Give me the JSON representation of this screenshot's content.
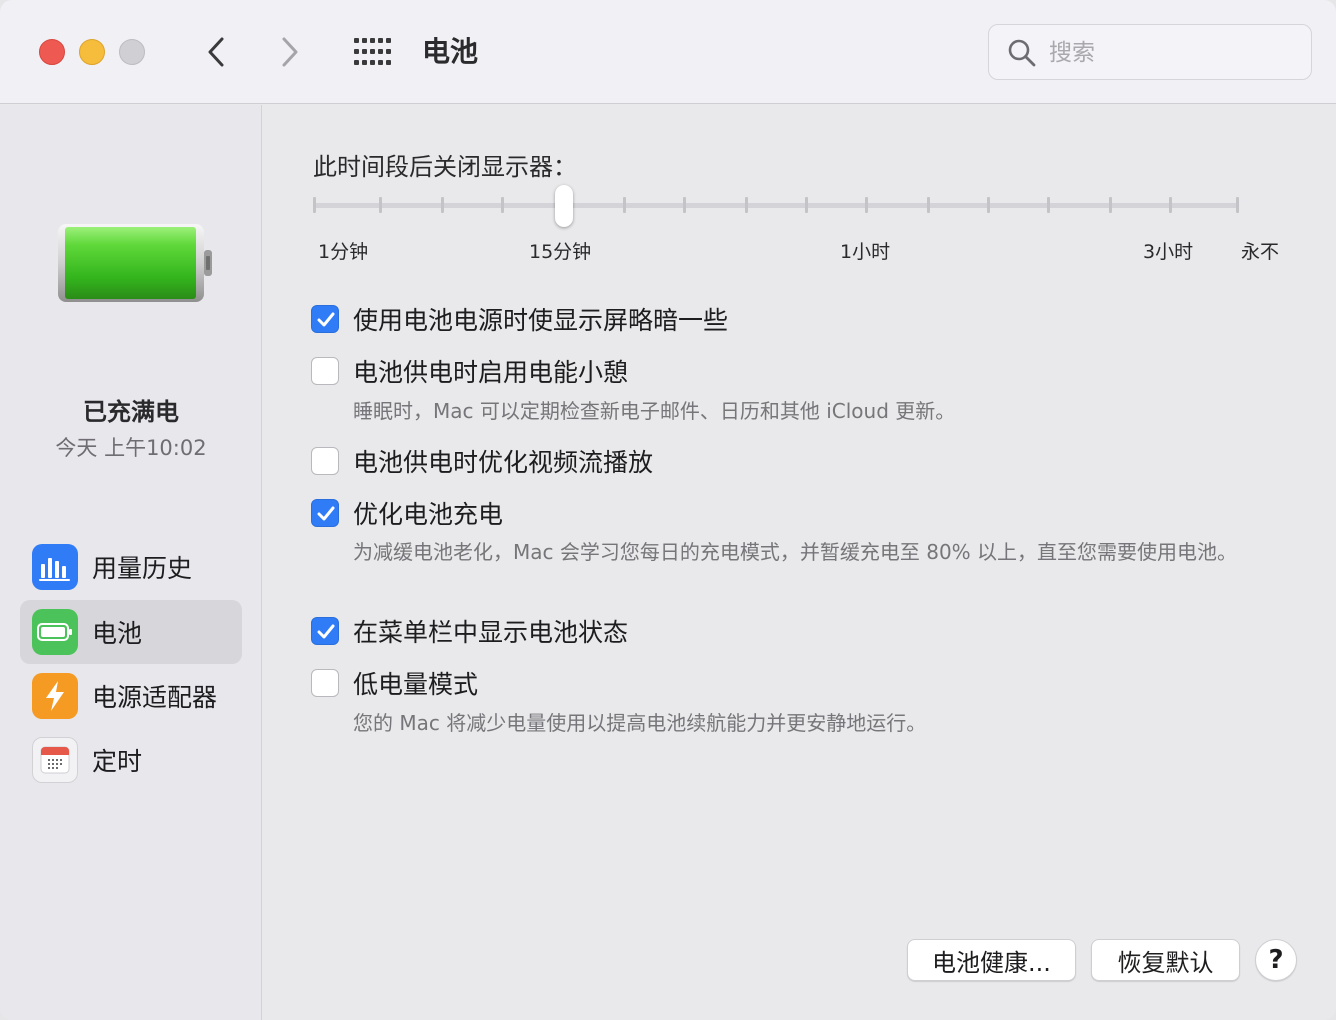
{
  "window": {
    "title": "电池",
    "search_placeholder": "搜索"
  },
  "sidebar": {
    "status_title": "已充满电",
    "status_time": "今天 上午10:02",
    "battery_level_percent": 100,
    "items": [
      {
        "label": "用量历史",
        "icon": "bar-chart-icon",
        "color": "#2f7cf6",
        "selected": false
      },
      {
        "label": "电池",
        "icon": "battery-icon",
        "color": "#4cc35a",
        "selected": true
      },
      {
        "label": "电源适配器",
        "icon": "bolt-icon",
        "color": "#f59a22",
        "selected": false
      },
      {
        "label": "定时",
        "icon": "calendar-icon",
        "color": "#e5584a",
        "selected": false
      }
    ]
  },
  "display_sleep": {
    "title": "此时间段后关闭显示器：",
    "labels": [
      "1分钟",
      "15分钟",
      "1小时",
      "3小时",
      "永不"
    ],
    "selected_value": "15分钟"
  },
  "options": [
    {
      "label": "使用电池电源时使显示屏略暗一些",
      "checked": true,
      "description": ""
    },
    {
      "label": "电池供电时启用电能小憩",
      "checked": false,
      "description": "睡眠时，Mac 可以定期检查新电子邮件、日历和其他 iCloud 更新。"
    },
    {
      "label": "电池供电时优化视频流播放",
      "checked": false,
      "description": ""
    },
    {
      "label": "优化电池充电",
      "checked": true,
      "description": "为减缓电池老化，Mac 会学习您每日的充电模式，并暂缓充电至 80% 以上，直至您需要使用电池。"
    },
    {
      "label": "在菜单栏中显示电池状态",
      "checked": true,
      "description": ""
    },
    {
      "label": "低电量模式",
      "checked": false,
      "description": "您的 Mac 将减少电量使用以提高电池续航能力并更安静地运行。"
    }
  ],
  "buttons": {
    "battery_health": "电池健康...",
    "restore_defaults": "恢复默认",
    "help": "?"
  },
  "colors": {
    "accent": "#2f7cf6",
    "battery_green": "#4cc35a"
  }
}
